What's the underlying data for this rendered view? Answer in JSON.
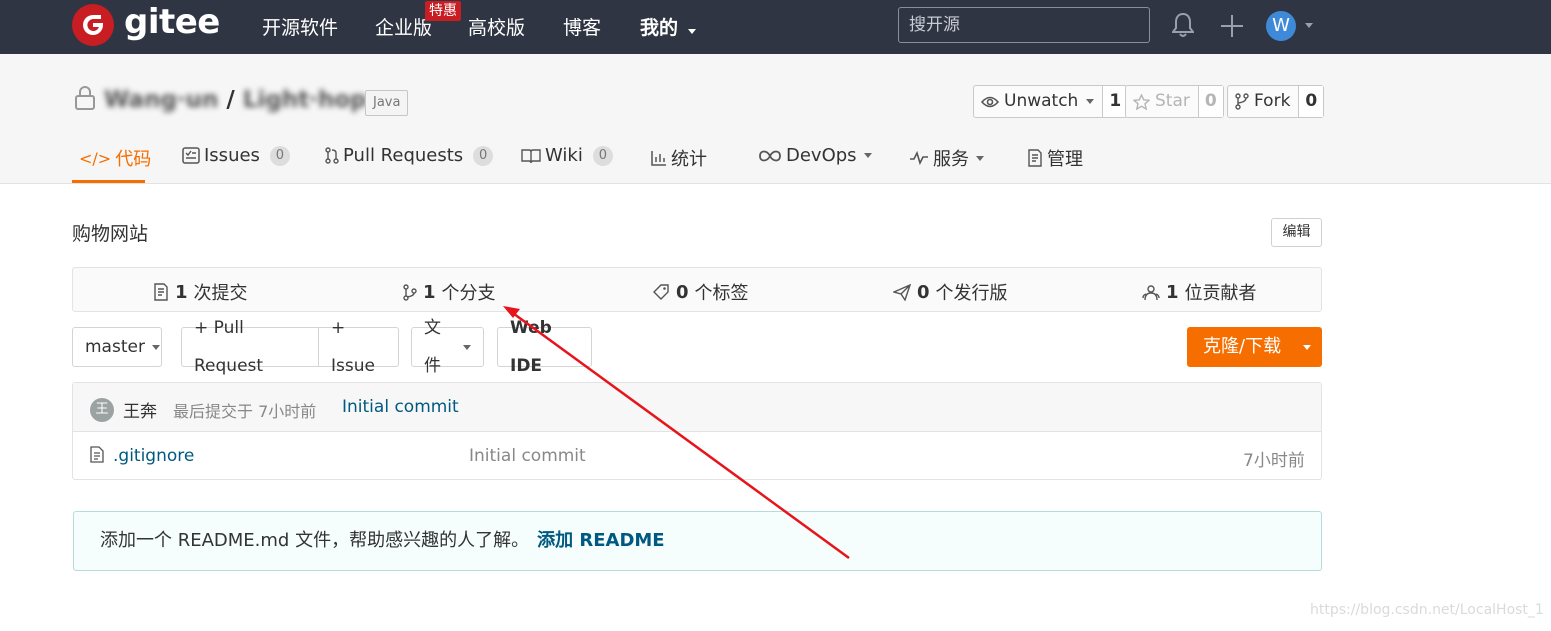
{
  "topnav": {
    "logo_text": "gitee",
    "links": [
      "开源软件",
      "企业版",
      "高校版",
      "博客",
      "我的"
    ],
    "badge": "特惠",
    "search_placeholder": "搜开源",
    "avatar_letter": "W"
  },
  "repo": {
    "owner": "Wang·un",
    "name": "Light·hop",
    "language": "Java",
    "watch_label": "Unwatch",
    "watch_count": "1",
    "star_label": "Star",
    "star_count": "0",
    "fork_label": "Fork",
    "fork_count": "0"
  },
  "tabs": [
    {
      "label": "代码"
    },
    {
      "label": "Issues",
      "count": "0"
    },
    {
      "label": "Pull Requests",
      "count": "0"
    },
    {
      "label": "Wiki",
      "count": "0"
    },
    {
      "label": "统计"
    },
    {
      "label": "DevOps"
    },
    {
      "label": "服务"
    },
    {
      "label": "管理"
    }
  ],
  "description": "购物网站",
  "edit_label": "编辑",
  "stats": [
    {
      "num": "1",
      "text": "次提交"
    },
    {
      "num": "1",
      "text": "个分支"
    },
    {
      "num": "0",
      "text": "个标签"
    },
    {
      "num": "0",
      "text": "个发行版"
    },
    {
      "num": "1",
      "text": "位贡献者"
    }
  ],
  "toolbar": {
    "branch": "master",
    "pull_request": "+ Pull Request",
    "issue": "+ Issue",
    "file": "文件",
    "web_ide": "Web IDE",
    "clone": "克隆/下载"
  },
  "last_commit": {
    "avatar": "王",
    "author": "王奔",
    "meta": "最后提交于 7小时前",
    "message": "Initial commit"
  },
  "files": [
    {
      "name": ".gitignore",
      "commit": "Initial commit",
      "time": "7小时前"
    }
  ],
  "readme_tip": {
    "text": "添加一个 README.md 文件，帮助感兴趣的人了解。",
    "link": "添加 README"
  },
  "watermark": "https://blog.csdn.net/LocalHost_1",
  "colors": {
    "accent": "#f66e00",
    "nav_bg": "#2f3542",
    "brand_red": "#c71d23",
    "annotation": "#e8141c"
  }
}
